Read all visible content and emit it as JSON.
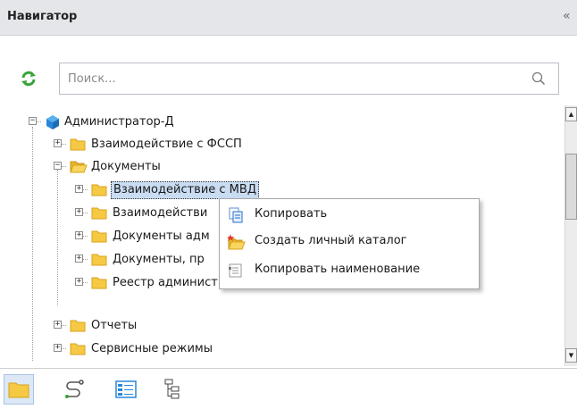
{
  "panel": {
    "title": "Навигатор",
    "collapse_glyph": "«"
  },
  "search": {
    "placeholder": "Поиск..."
  },
  "tree": {
    "root": "Администратор-Д",
    "items": [
      "Взаимодействие с ФССП",
      "Документы",
      "Взаимодействие с МВД",
      "Взаимодействи",
      "Документы адм",
      "Документы, пр",
      "Реестр администрируемых доходов",
      "Отчеты",
      "Сервисные режимы"
    ]
  },
  "context_menu": {
    "items": [
      {
        "label": "Копировать",
        "icon": "copy-icon"
      },
      {
        "label": "Создать личный каталог",
        "icon": "new-folder-icon"
      },
      {
        "label": "Копировать наименование",
        "icon": "copy-name-icon"
      }
    ]
  },
  "toolbar": {
    "buttons": [
      "folder-icon",
      "route-icon",
      "list-view-icon",
      "tree-view-icon"
    ]
  },
  "colors": {
    "header_bg": "#e4e6ea",
    "selection_bg": "#c9dcf2",
    "folder_yellow": "#f6c945",
    "accent_blue": "#2a86d8"
  }
}
